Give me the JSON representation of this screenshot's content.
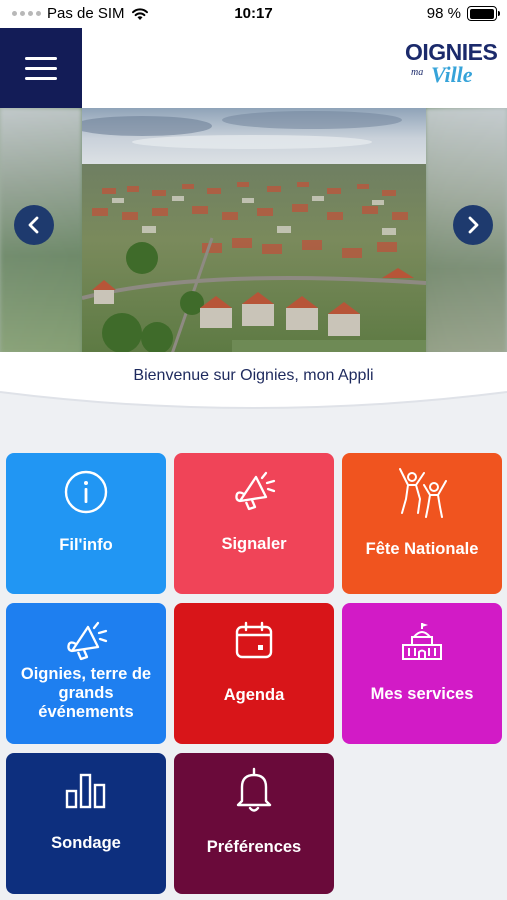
{
  "status_bar": {
    "carrier": "Pas de SIM",
    "time": "10:17",
    "battery": "98 %",
    "battery_level": 0.98
  },
  "header": {
    "menu_icon": "hamburger-menu-icon",
    "logo": {
      "line1": "OIGNIES",
      "line2": "ma",
      "line3": "Ville"
    }
  },
  "carousel": {
    "prev_icon": "chevron-left-icon",
    "next_icon": "chevron-right-icon"
  },
  "welcome": {
    "text": "Bienvenue sur Oignies, mon Appli"
  },
  "tiles": [
    {
      "label": "Fil'info",
      "icon": "info-circle-icon",
      "color": "#2196f3"
    },
    {
      "label": "Signaler",
      "icon": "megaphone-icon",
      "color": "#f04458"
    },
    {
      "label": "Fête Nationale",
      "icon": "people-celebrating-icon",
      "color": "#f0541f"
    },
    {
      "label": "Oignies, terre de grands événements",
      "icon": "megaphone-icon",
      "color": "#1e7ff0"
    },
    {
      "label": "Agenda",
      "icon": "calendar-icon",
      "color": "#d81519"
    },
    {
      "label": "Mes services",
      "icon": "town-hall-icon",
      "color": "#d21bc6"
    },
    {
      "label": "Sondage",
      "icon": "bar-chart-icon",
      "color": "#0d2f7e"
    },
    {
      "label": "Préférences",
      "icon": "bell-icon",
      "color": "#6a0a3a"
    }
  ]
}
